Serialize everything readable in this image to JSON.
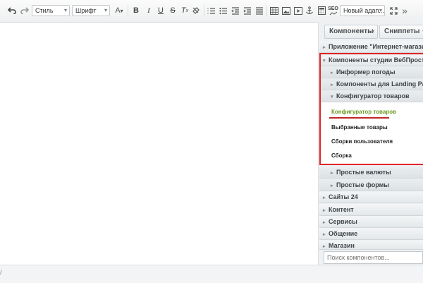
{
  "toolbar": {
    "style_select": "Стиль",
    "font_select": "Шрифт",
    "text_size_label": "A",
    "bold": "B",
    "italic": "I",
    "underline": "U",
    "strike": "S",
    "clear_format": "T",
    "seo_label": "SEO",
    "new_select": "Новый адап...",
    "more": "»",
    "icons": [
      "undo-icon",
      "redo-icon",
      "text-size-icon",
      "bold-icon",
      "italic-icon",
      "underline-icon",
      "strikethrough-icon",
      "remove-format-icon",
      "text-color-icon",
      "numbered-list-icon",
      "bulleted-list-icon",
      "outdent-icon",
      "indent-icon",
      "align-icon",
      "table-icon",
      "image-icon",
      "video-icon",
      "anchor-icon",
      "calculator-icon",
      "seo-icon",
      "fullscreen-icon",
      "more-icon"
    ]
  },
  "panel": {
    "tabs": {
      "components": "Компоненты",
      "snippets": "Сниппеты"
    },
    "tree": {
      "shop_app": "Приложение \"Интернет-магазин\"",
      "webprostor": "Компоненты студии ВебПростор",
      "weather": "Информер погоды",
      "landing": "Компоненты для Landing Page",
      "configurator": "Конфигуратор товаров",
      "simple_currencies": "Простые валюты",
      "simple_forms": "Простые формы",
      "sites24": "Сайты 24",
      "content": "Контент",
      "services": "Сервисы",
      "communication": "Общение",
      "shops": "Магазин"
    },
    "items": {
      "configurator_item": "Конфигуратор товаров",
      "selected_goods": "Выбранные товары",
      "user_builds": "Сборки пользователя",
      "build": "Сборка"
    },
    "search_placeholder": "Поиск компонентов..."
  },
  "status": {
    "mark": "/"
  },
  "colors": {
    "highlight": "#e02424",
    "active_item": "#6d9b22",
    "underline": "#c22525"
  }
}
